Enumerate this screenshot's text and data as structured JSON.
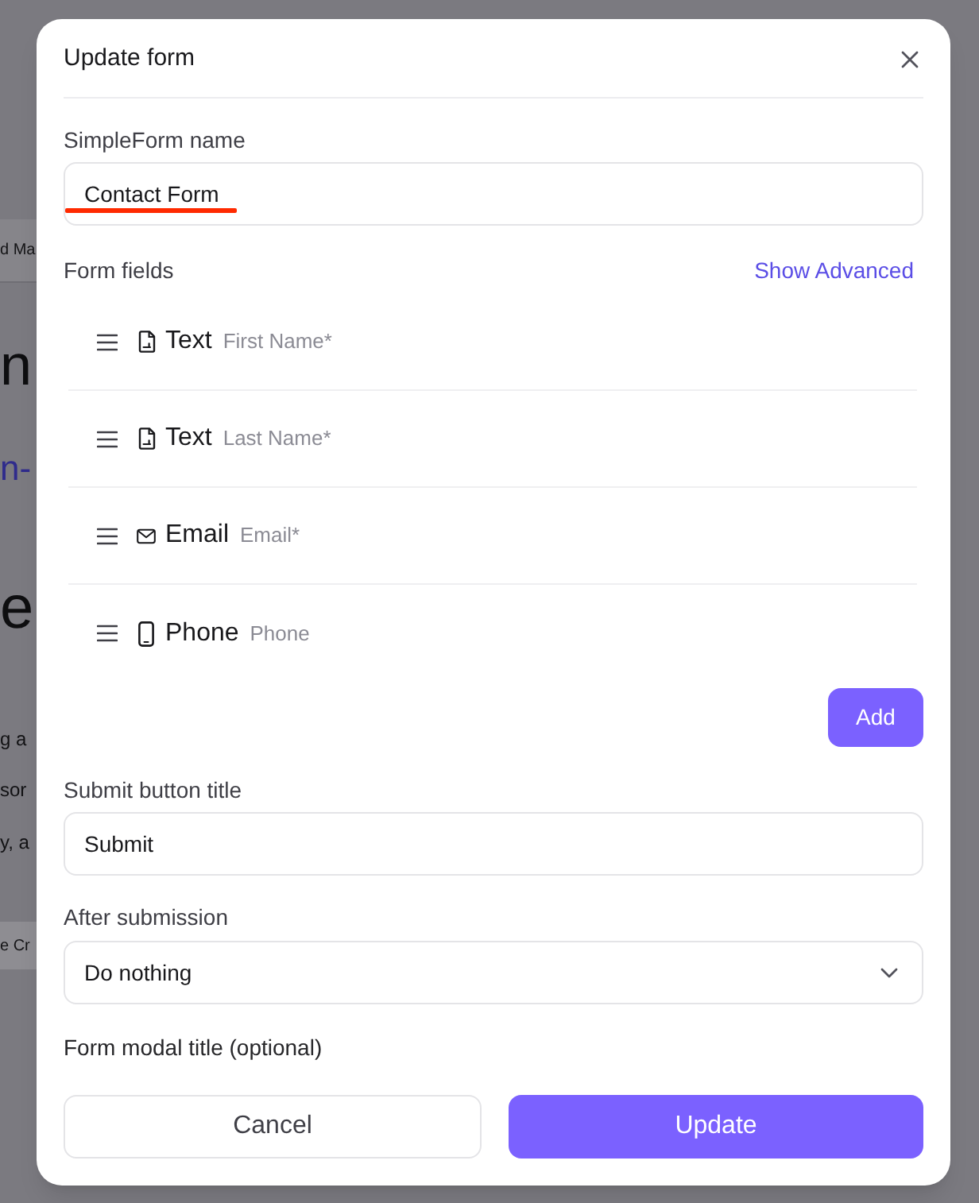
{
  "background_page": {
    "tab": "d Ma",
    "heading_lines": [
      {
        "text": "n",
        "kind": "plain"
      },
      {
        "text": "n-",
        "kind": "accent"
      },
      {
        "text": "e",
        "kind": "plain"
      }
    ],
    "paragraph_lines": [
      "g a",
      "sor",
      "y, a"
    ],
    "button": "e Cr"
  },
  "dialog": {
    "title": "Update form",
    "name_field": {
      "label": "SimpleForm name",
      "value": "Contact Form",
      "underlined": true
    },
    "form_fields": {
      "label": "Form fields",
      "link": "Show Advanced",
      "items": [
        {
          "kind": "text",
          "type": "Text",
          "name": "First Name*"
        },
        {
          "kind": "text",
          "type": "Text",
          "name": "Last Name*"
        },
        {
          "kind": "email",
          "type": "Email",
          "name": "Email*"
        },
        {
          "kind": "phone",
          "type": "Phone",
          "name": "Phone"
        }
      ],
      "add_button": "Add"
    },
    "submit_field": {
      "label": "Submit button title",
      "value": "Submit"
    },
    "after_submission": {
      "label": "After submission",
      "value": "Do nothing"
    },
    "modal_title_label": "Form modal title (optional)",
    "buttons": [
      {
        "kind": "secondary",
        "label": "Cancel"
      },
      {
        "kind": "primary",
        "label": "Update"
      }
    ]
  }
}
